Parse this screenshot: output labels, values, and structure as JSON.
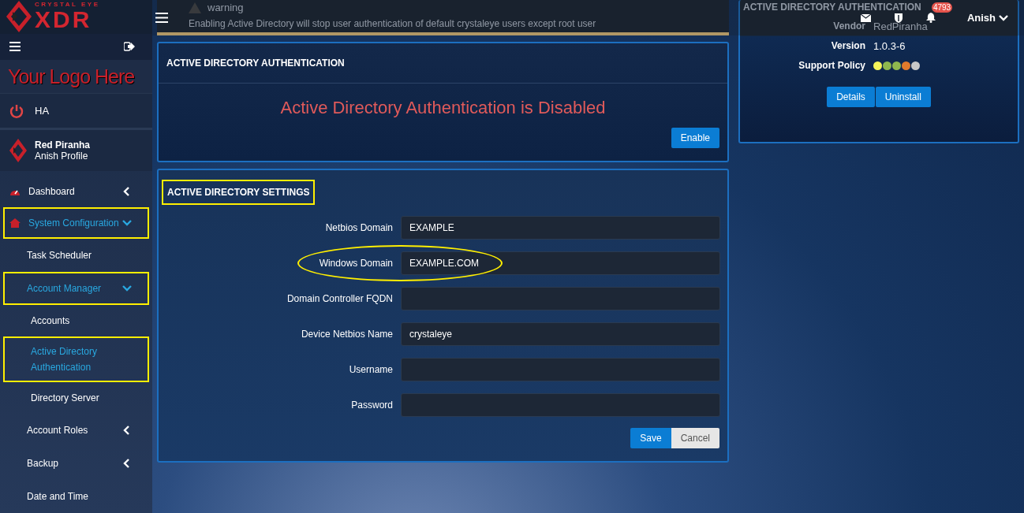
{
  "brand": {
    "tagline": "CRYSTAL EYE",
    "name": "XDR"
  },
  "sidebar": {
    "logo_text": "Your Logo Here",
    "ha": "HA",
    "profile": {
      "name": "Red Piranha",
      "subtitle": "Anish Profile"
    },
    "items": [
      {
        "label": "Dashboard",
        "expanded": false,
        "selected": false,
        "highlighted": false
      },
      {
        "label": "System Configuration",
        "expanded": true,
        "selected": true,
        "highlighted": true,
        "children": [
          {
            "label": "Task Scheduler",
            "selected": false,
            "highlighted": false
          },
          {
            "label": "Account Manager",
            "expanded": true,
            "selected": true,
            "highlighted": true,
            "children": [
              {
                "label": "Accounts",
                "selected": false,
                "highlighted": false
              },
              {
                "label": "Active Directory Authentication",
                "selected": true,
                "highlighted": true
              },
              {
                "label": "Directory Server",
                "selected": false,
                "highlighted": false
              }
            ]
          },
          {
            "label": "Account Roles",
            "expanded": false,
            "selected": false,
            "highlighted": false
          },
          {
            "label": "Backup",
            "expanded": false,
            "selected": false,
            "highlighted": false
          },
          {
            "label": "Date and Time",
            "selected": false,
            "highlighted": false
          }
        ]
      }
    ]
  },
  "topbar": {
    "notification_count": "4793",
    "user": "Anish"
  },
  "warning": {
    "title": "warning",
    "message": "Enabling Active Directory will stop user authentication of default crystaleye users except root user"
  },
  "auth_panel": {
    "title": "ACTIVE DIRECTORY AUTHENTICATION",
    "status": "Active Directory Authentication is Disabled",
    "button": "Enable"
  },
  "settings_panel": {
    "title": "ACTIVE DIRECTORY SETTINGS",
    "title_highlighted": true,
    "fields": [
      {
        "label": "Netbios Domain",
        "value": "EXAMPLE",
        "highlighted": false
      },
      {
        "label": "Windows Domain",
        "value": "EXAMPLE.COM",
        "highlighted": true
      },
      {
        "label": "Domain Controller FQDN",
        "highlighted": false
      },
      {
        "label": "Device Netbios Name",
        "value": "crystaleye",
        "highlighted": false
      },
      {
        "label": "Username",
        "highlighted": false
      },
      {
        "label": "Password",
        "highlighted": false
      }
    ],
    "buttons": [
      {
        "label": "Save",
        "kind": "primary"
      },
      {
        "label": "Cancel",
        "kind": "secondary"
      }
    ]
  },
  "app_card": {
    "title": "ACTIVE DIRECTORY AUTHENTICATION",
    "rows": [
      {
        "label": "Vendor",
        "value": "RedPiranha"
      },
      {
        "label": "Version",
        "value": "1.0.3-6"
      }
    ],
    "support_label": "Support Policy",
    "support_dots": [
      {
        "color": "#f5f55a"
      },
      {
        "color": "#8fb84e"
      },
      {
        "color": "#8fb84e"
      },
      {
        "color": "#e07a2c"
      },
      {
        "color": "#c8c8c8"
      }
    ],
    "buttons": [
      "Details",
      "Uninstall"
    ]
  }
}
